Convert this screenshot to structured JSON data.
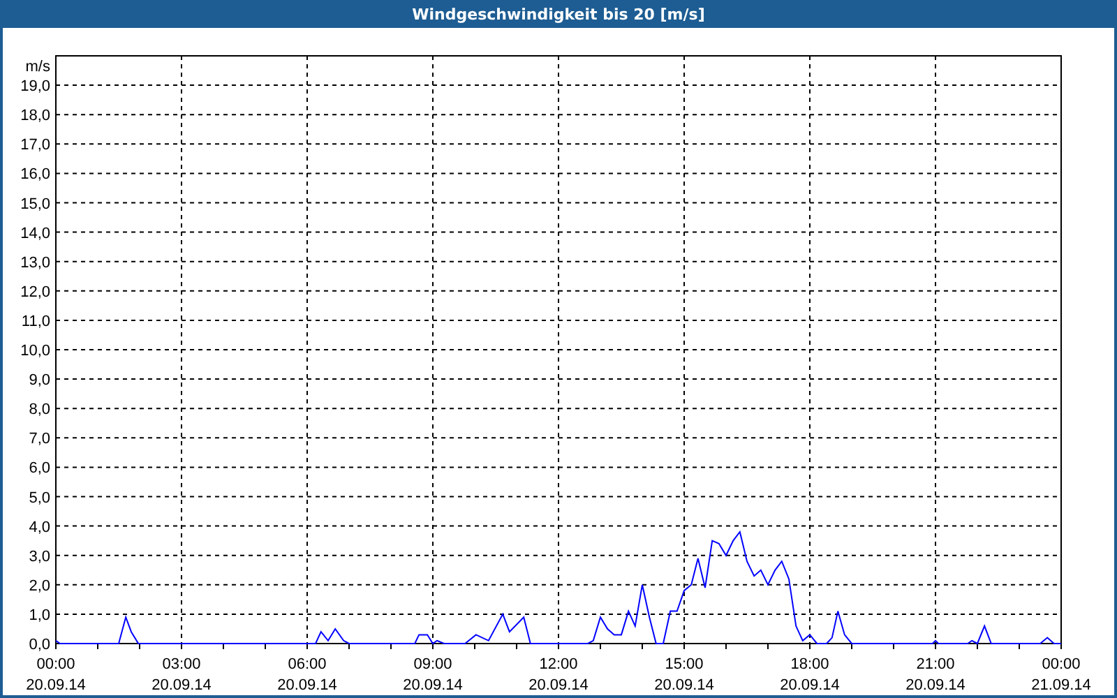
{
  "window": {
    "title": "Windgeschwindigkeit bis 20 [m/s]"
  },
  "chart": {
    "x_dates": [
      "20.09.14",
      "20.09.14",
      "20.09.14",
      "20.09.14",
      "20.09.14",
      "20.09.14",
      "20.09.14",
      "20.09.14",
      "21.09.14"
    ],
    "chart_data": {
      "type": "line",
      "grid": true,
      "ylabel": "m/s",
      "xlim": [
        0,
        24
      ],
      "ylim": [
        0,
        20
      ],
      "x": [
        0,
        0.1,
        1.5,
        1.67,
        1.8,
        1.97,
        6.2,
        6.33,
        6.5,
        6.67,
        6.87,
        7.0,
        8.57,
        8.67,
        8.87,
        9.0,
        9.1,
        9.27,
        9.77,
        10.03,
        10.33,
        10.67,
        10.83,
        11.17,
        11.33,
        12.7,
        12.83,
        13.0,
        13.17,
        13.33,
        13.5,
        13.67,
        13.83,
        14.0,
        14.17,
        14.33,
        14.5,
        14.67,
        14.83,
        15.0,
        15.17,
        15.33,
        15.5,
        15.67,
        15.83,
        16.0,
        16.17,
        16.33,
        16.5,
        16.67,
        16.83,
        17.0,
        17.17,
        17.33,
        17.5,
        17.67,
        17.83,
        18.0,
        18.17,
        18.4,
        18.53,
        18.67,
        18.83,
        19.0,
        20.93,
        21.0,
        21.07,
        21.77,
        21.87,
        22.0,
        22.17,
        22.33,
        23.5,
        23.67,
        23.83,
        24
      ],
      "series": [
        {
          "color": "#0000ff",
          "values": [
            0.1,
            0,
            0,
            0.9,
            0.4,
            0,
            0,
            0.4,
            0.1,
            0.5,
            0.1,
            0,
            0,
            0.3,
            0.3,
            0,
            0.1,
            0,
            0,
            0.3,
            0.1,
            1.0,
            0.4,
            0.9,
            0,
            0,
            0.1,
            0.9,
            0.5,
            0.3,
            0.3,
            1.1,
            0.6,
            2.0,
            0.9,
            0,
            0,
            1.1,
            1.1,
            1.8,
            2.0,
            2.9,
            1.9,
            3.5,
            3.4,
            3.0,
            3.5,
            3.8,
            2.8,
            2.3,
            2.5,
            2.0,
            2.5,
            2.8,
            2.2,
            0.6,
            0.1,
            0.3,
            0,
            0,
            0.2,
            1.1,
            0.3,
            0,
            0,
            0.1,
            0,
            0,
            0.1,
            0,
            0.6,
            0,
            0,
            0.2,
            0,
            0
          ]
        }
      ],
      "xticks": [
        {
          "value": 0,
          "label": "00:00"
        },
        {
          "value": 3,
          "label": "03:00"
        },
        {
          "value": 6,
          "label": "06:00"
        },
        {
          "value": 9,
          "label": "09:00"
        },
        {
          "value": 12,
          "label": "12:00"
        },
        {
          "value": 15,
          "label": "15:00"
        },
        {
          "value": 18,
          "label": "18:00"
        },
        {
          "value": 21,
          "label": "21:00"
        },
        {
          "value": 24,
          "label": "00:00"
        }
      ],
      "yticks": [
        {
          "value": 0,
          "label": "0,0"
        },
        {
          "value": 1,
          "label": "1,0"
        },
        {
          "value": 2,
          "label": "2,0"
        },
        {
          "value": 3,
          "label": "3,0"
        },
        {
          "value": 4,
          "label": "4,0"
        },
        {
          "value": 5,
          "label": "5,0"
        },
        {
          "value": 6,
          "label": "6,0"
        },
        {
          "value": 7,
          "label": "7,0"
        },
        {
          "value": 8,
          "label": "8,0"
        },
        {
          "value": 9,
          "label": "9,0"
        },
        {
          "value": 10,
          "label": "10,0"
        },
        {
          "value": 11,
          "label": "11,0"
        },
        {
          "value": 12,
          "label": "12,0"
        },
        {
          "value": 13,
          "label": "13,0"
        },
        {
          "value": 14,
          "label": "14,0"
        },
        {
          "value": 15,
          "label": "15,0"
        },
        {
          "value": 16,
          "label": "16,0"
        },
        {
          "value": 17,
          "label": "17,0"
        },
        {
          "value": 18,
          "label": "18,0"
        },
        {
          "value": 19,
          "label": "19,0"
        }
      ]
    }
  }
}
